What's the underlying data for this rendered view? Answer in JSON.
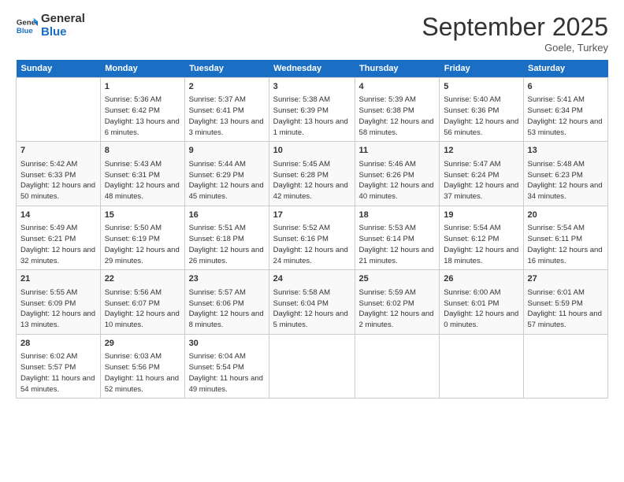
{
  "logo": {
    "line1": "General",
    "line2": "Blue"
  },
  "title": "September 2025",
  "subtitle": "Goele, Turkey",
  "days_of_week": [
    "Sunday",
    "Monday",
    "Tuesday",
    "Wednesday",
    "Thursday",
    "Friday",
    "Saturday"
  ],
  "weeks": [
    [
      {
        "day": "",
        "sunrise": "",
        "sunset": "",
        "daylight": ""
      },
      {
        "day": "1",
        "sunrise": "Sunrise: 5:36 AM",
        "sunset": "Sunset: 6:42 PM",
        "daylight": "Daylight: 13 hours and 6 minutes."
      },
      {
        "day": "2",
        "sunrise": "Sunrise: 5:37 AM",
        "sunset": "Sunset: 6:41 PM",
        "daylight": "Daylight: 13 hours and 3 minutes."
      },
      {
        "day": "3",
        "sunrise": "Sunrise: 5:38 AM",
        "sunset": "Sunset: 6:39 PM",
        "daylight": "Daylight: 13 hours and 1 minute."
      },
      {
        "day": "4",
        "sunrise": "Sunrise: 5:39 AM",
        "sunset": "Sunset: 6:38 PM",
        "daylight": "Daylight: 12 hours and 58 minutes."
      },
      {
        "day": "5",
        "sunrise": "Sunrise: 5:40 AM",
        "sunset": "Sunset: 6:36 PM",
        "daylight": "Daylight: 12 hours and 56 minutes."
      },
      {
        "day": "6",
        "sunrise": "Sunrise: 5:41 AM",
        "sunset": "Sunset: 6:34 PM",
        "daylight": "Daylight: 12 hours and 53 minutes."
      }
    ],
    [
      {
        "day": "7",
        "sunrise": "Sunrise: 5:42 AM",
        "sunset": "Sunset: 6:33 PM",
        "daylight": "Daylight: 12 hours and 50 minutes."
      },
      {
        "day": "8",
        "sunrise": "Sunrise: 5:43 AM",
        "sunset": "Sunset: 6:31 PM",
        "daylight": "Daylight: 12 hours and 48 minutes."
      },
      {
        "day": "9",
        "sunrise": "Sunrise: 5:44 AM",
        "sunset": "Sunset: 6:29 PM",
        "daylight": "Daylight: 12 hours and 45 minutes."
      },
      {
        "day": "10",
        "sunrise": "Sunrise: 5:45 AM",
        "sunset": "Sunset: 6:28 PM",
        "daylight": "Daylight: 12 hours and 42 minutes."
      },
      {
        "day": "11",
        "sunrise": "Sunrise: 5:46 AM",
        "sunset": "Sunset: 6:26 PM",
        "daylight": "Daylight: 12 hours and 40 minutes."
      },
      {
        "day": "12",
        "sunrise": "Sunrise: 5:47 AM",
        "sunset": "Sunset: 6:24 PM",
        "daylight": "Daylight: 12 hours and 37 minutes."
      },
      {
        "day": "13",
        "sunrise": "Sunrise: 5:48 AM",
        "sunset": "Sunset: 6:23 PM",
        "daylight": "Daylight: 12 hours and 34 minutes."
      }
    ],
    [
      {
        "day": "14",
        "sunrise": "Sunrise: 5:49 AM",
        "sunset": "Sunset: 6:21 PM",
        "daylight": "Daylight: 12 hours and 32 minutes."
      },
      {
        "day": "15",
        "sunrise": "Sunrise: 5:50 AM",
        "sunset": "Sunset: 6:19 PM",
        "daylight": "Daylight: 12 hours and 29 minutes."
      },
      {
        "day": "16",
        "sunrise": "Sunrise: 5:51 AM",
        "sunset": "Sunset: 6:18 PM",
        "daylight": "Daylight: 12 hours and 26 minutes."
      },
      {
        "day": "17",
        "sunrise": "Sunrise: 5:52 AM",
        "sunset": "Sunset: 6:16 PM",
        "daylight": "Daylight: 12 hours and 24 minutes."
      },
      {
        "day": "18",
        "sunrise": "Sunrise: 5:53 AM",
        "sunset": "Sunset: 6:14 PM",
        "daylight": "Daylight: 12 hours and 21 minutes."
      },
      {
        "day": "19",
        "sunrise": "Sunrise: 5:54 AM",
        "sunset": "Sunset: 6:12 PM",
        "daylight": "Daylight: 12 hours and 18 minutes."
      },
      {
        "day": "20",
        "sunrise": "Sunrise: 5:54 AM",
        "sunset": "Sunset: 6:11 PM",
        "daylight": "Daylight: 12 hours and 16 minutes."
      }
    ],
    [
      {
        "day": "21",
        "sunrise": "Sunrise: 5:55 AM",
        "sunset": "Sunset: 6:09 PM",
        "daylight": "Daylight: 12 hours and 13 minutes."
      },
      {
        "day": "22",
        "sunrise": "Sunrise: 5:56 AM",
        "sunset": "Sunset: 6:07 PM",
        "daylight": "Daylight: 12 hours and 10 minutes."
      },
      {
        "day": "23",
        "sunrise": "Sunrise: 5:57 AM",
        "sunset": "Sunset: 6:06 PM",
        "daylight": "Daylight: 12 hours and 8 minutes."
      },
      {
        "day": "24",
        "sunrise": "Sunrise: 5:58 AM",
        "sunset": "Sunset: 6:04 PM",
        "daylight": "Daylight: 12 hours and 5 minutes."
      },
      {
        "day": "25",
        "sunrise": "Sunrise: 5:59 AM",
        "sunset": "Sunset: 6:02 PM",
        "daylight": "Daylight: 12 hours and 2 minutes."
      },
      {
        "day": "26",
        "sunrise": "Sunrise: 6:00 AM",
        "sunset": "Sunset: 6:01 PM",
        "daylight": "Daylight: 12 hours and 0 minutes."
      },
      {
        "day": "27",
        "sunrise": "Sunrise: 6:01 AM",
        "sunset": "Sunset: 5:59 PM",
        "daylight": "Daylight: 11 hours and 57 minutes."
      }
    ],
    [
      {
        "day": "28",
        "sunrise": "Sunrise: 6:02 AM",
        "sunset": "Sunset: 5:57 PM",
        "daylight": "Daylight: 11 hours and 54 minutes."
      },
      {
        "day": "29",
        "sunrise": "Sunrise: 6:03 AM",
        "sunset": "Sunset: 5:56 PM",
        "daylight": "Daylight: 11 hours and 52 minutes."
      },
      {
        "day": "30",
        "sunrise": "Sunrise: 6:04 AM",
        "sunset": "Sunset: 5:54 PM",
        "daylight": "Daylight: 11 hours and 49 minutes."
      },
      {
        "day": "",
        "sunrise": "",
        "sunset": "",
        "daylight": ""
      },
      {
        "day": "",
        "sunrise": "",
        "sunset": "",
        "daylight": ""
      },
      {
        "day": "",
        "sunrise": "",
        "sunset": "",
        "daylight": ""
      },
      {
        "day": "",
        "sunrise": "",
        "sunset": "",
        "daylight": ""
      }
    ]
  ]
}
